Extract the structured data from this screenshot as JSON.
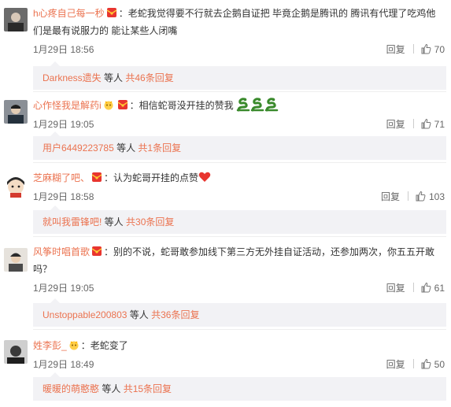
{
  "comments": [
    {
      "username": "h心疼自己每一秒",
      "text": "：老蛇我觉得要不行就去企鹅自证把   毕竟企鹅是腾讯的    腾讯有代理了吃鸡他们是最有说服力的   能让某些人闭嘴",
      "time": "1月29日 18:56",
      "reply_label": "回复",
      "likes": "70",
      "sub": {
        "name": "Darkness遗失",
        "middle": " 等人 ",
        "total": "共46条回复"
      }
    },
    {
      "username": "心作怪我是解药i",
      "text": "：相信蛇哥没开挂的赞我",
      "time": "1月29日 19:05",
      "reply_label": "回复",
      "likes": "71",
      "sub": {
        "name": "用户6449223785",
        "middle": " 等人 ",
        "total": "共1条回复"
      }
    },
    {
      "username": "芝麻糊了吧、",
      "text": "：认为蛇哥开挂的点赞",
      "time": "1月29日 18:58",
      "reply_label": "回复",
      "likes": "103",
      "sub": {
        "name": "就叫我雷锋吧!",
        "middle": " 等人 ",
        "total": "共30条回复"
      }
    },
    {
      "username": "风筝时唱首歌",
      "text": "：别的不说，蛇哥敢参加线下第三方无外挂自证活动，还参加两次，你五五开敢吗？",
      "time": "1月29日 19:05",
      "reply_label": "回复",
      "likes": "61",
      "sub": {
        "name": "Unstoppable200803",
        "middle": " 等人 ",
        "total": "共36条回复"
      }
    },
    {
      "username": "姓李彭_",
      "text": "：老蛇变了",
      "time": "1月29日 18:49",
      "reply_label": "回复",
      "likes": "50",
      "sub": {
        "name": "暖暖的萌憨憨",
        "middle": " 等人 ",
        "total": "共15条回复"
      }
    }
  ],
  "icons": {
    "badge": "red-envelope-badge-icon",
    "like": "thumbs-up-icon",
    "emoji_snake": "snake-emoji-icon",
    "emoji_heart": "heart-emoji-icon"
  },
  "colors": {
    "link": "#eb7350",
    "subbox_bg": "#f2f2f5",
    "meta_text": "#666666"
  }
}
